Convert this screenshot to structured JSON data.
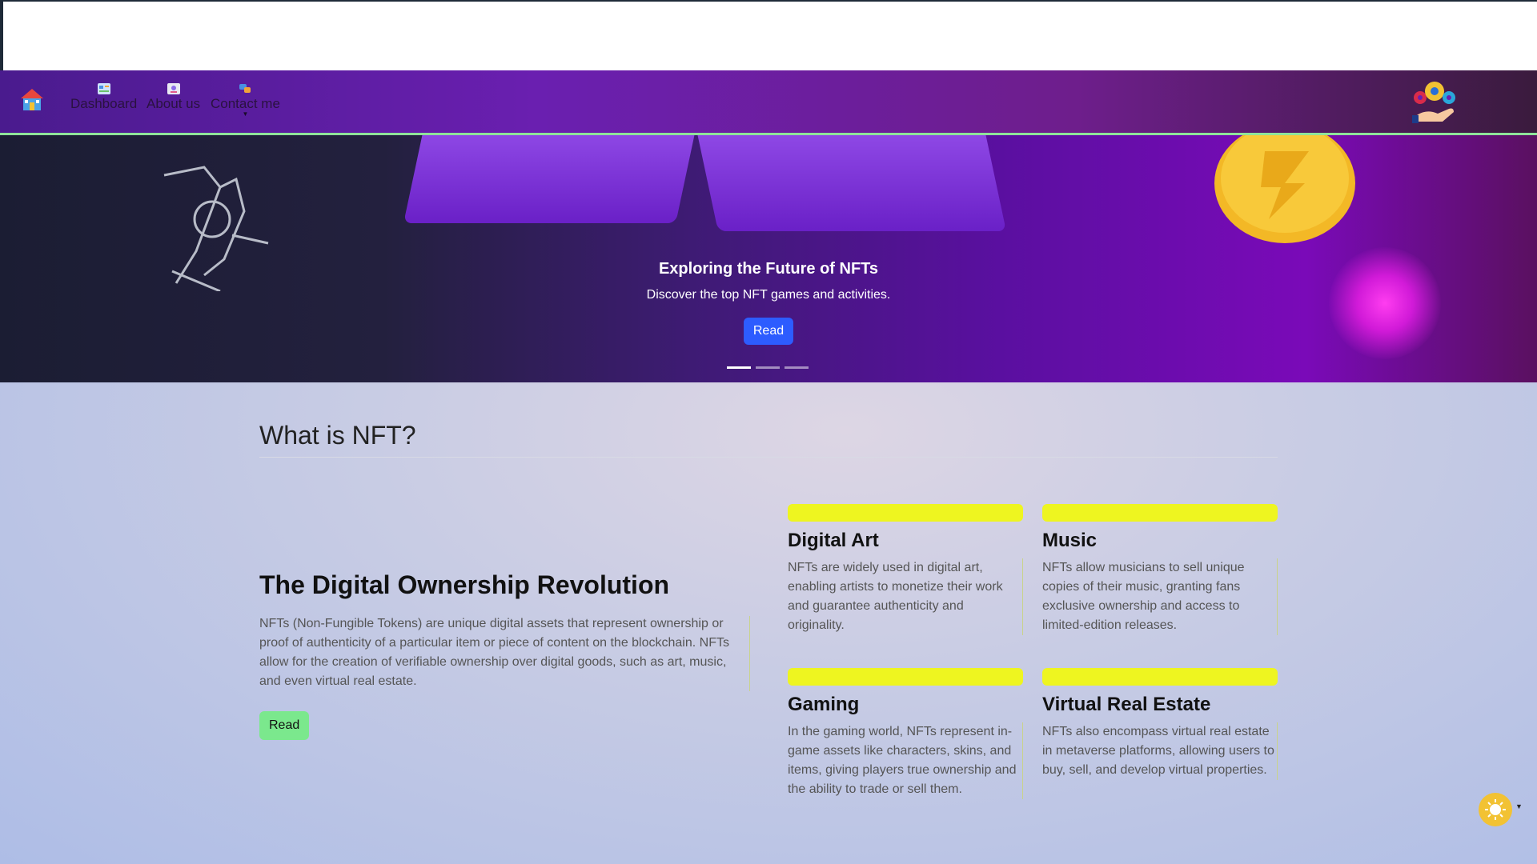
{
  "nav": {
    "items": [
      {
        "label": "Dashboard"
      },
      {
        "label": "About us"
      },
      {
        "label": "Contact me"
      }
    ]
  },
  "hero": {
    "title": "Exploring the Future of NFTs",
    "subtitle": "Discover the top NFT games and activities.",
    "button": "Read",
    "slides": 3,
    "active_slide": 1
  },
  "section": {
    "title": "What is NFT?",
    "lead_title": "The Digital Ownership Revolution",
    "lead_text": "NFTs (Non-Fungible Tokens) are unique digital assets that represent ownership or proof of authenticity of a particular item or piece of content on the blockchain. NFTs allow for the creation of verifiable ownership over digital goods, such as art, music, and even virtual real estate.",
    "lead_button": "Read",
    "cards": [
      {
        "title": "Digital Art",
        "text": "NFTs are widely used in digital art, enabling artists to monetize their work and guarantee authenticity and originality."
      },
      {
        "title": "Music",
        "text": "NFTs allow musicians to sell unique copies of their music, granting fans exclusive ownership and access to limited-edition releases."
      },
      {
        "title": "Gaming",
        "text": "In the gaming world, NFTs represent in-game assets like characters, skins, and items, giving players true ownership and the ability to trade or sell them."
      },
      {
        "title": "Virtual Real Estate",
        "text": "NFTs also encompass virtual real estate in metaverse platforms, allowing users to buy, sell, and develop virtual properties."
      }
    ]
  },
  "colors": {
    "accent_yellow": "#eef520",
    "read_blue": "#2d5cff",
    "read_green": "#7be88d",
    "nav_border": "#8fe39a"
  },
  "icons": [
    "home-icon",
    "dashboard-icon",
    "about-icon",
    "contact-icon",
    "logo-gears-icon",
    "sun-icon"
  ]
}
